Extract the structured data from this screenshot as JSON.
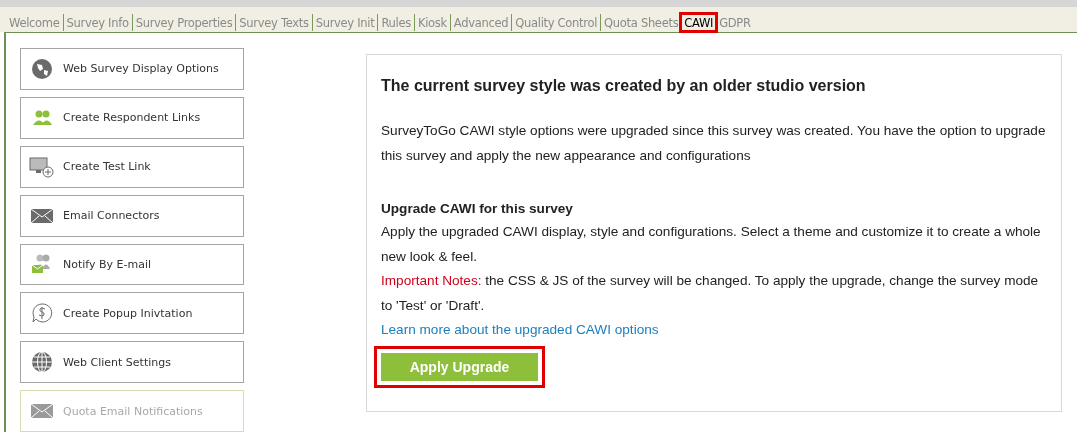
{
  "tabs": [
    {
      "label": "Welcome",
      "selected": false,
      "highlighted": false
    },
    {
      "label": "Survey Info",
      "selected": false,
      "highlighted": false
    },
    {
      "label": "Survey Properties",
      "selected": false,
      "highlighted": false
    },
    {
      "label": "Survey Texts",
      "selected": false,
      "highlighted": false
    },
    {
      "label": "Survey Init",
      "selected": false,
      "highlighted": false
    },
    {
      "label": "Rules",
      "selected": false,
      "highlighted": false
    },
    {
      "label": "Kiosk",
      "selected": false,
      "highlighted": false
    },
    {
      "label": "Advanced",
      "selected": false,
      "highlighted": false
    },
    {
      "label": "Quality Control",
      "selected": false,
      "highlighted": false
    },
    {
      "label": "Quota Sheets",
      "selected": false,
      "highlighted": false
    },
    {
      "label": "CAWI",
      "selected": true,
      "highlighted": true
    },
    {
      "label": "GDPR",
      "selected": false,
      "highlighted": false
    }
  ],
  "sidebar": {
    "items": [
      {
        "label": "Web Survey Display Options",
        "kind": "globe",
        "disabled": false
      },
      {
        "label": "Create Respondent Links",
        "kind": "people",
        "disabled": false
      },
      {
        "label": "Create Test Link",
        "kind": "monitor",
        "disabled": false
      },
      {
        "label": "Email Connectors",
        "kind": "envelope",
        "disabled": false
      },
      {
        "label": "Notify By E-mail",
        "kind": "notify",
        "disabled": false
      },
      {
        "label": "Create Popup Inivtation",
        "kind": "dollar",
        "disabled": false
      },
      {
        "label": "Web Client Settings",
        "kind": "web",
        "disabled": false
      },
      {
        "label": "Quota Email Notifications",
        "kind": "envelope",
        "disabled": true
      }
    ]
  },
  "notice": {
    "title": "The current survey style was created by an older studio version",
    "intro": "SurveyToGo CAWI style options were upgraded since this survey was created. You have the option to upgrade this survey and apply the new appearance and configurations",
    "section_title": "Upgrade CAWI for this survey",
    "description": "Apply the upgraded CAWI display, style and configurations. Select a theme and customize it to create a whole new look & feel.",
    "note_label": "Important Notes:",
    "note_text": "the CSS & JS of the survey will be changed. To apply the upgrade, change the survey mode to 'Test' or 'Draft'.",
    "link": "Learn more about the upgraded CAWI options",
    "button": {
      "label": "Apply Upgrade",
      "highlighted": true
    }
  }
}
